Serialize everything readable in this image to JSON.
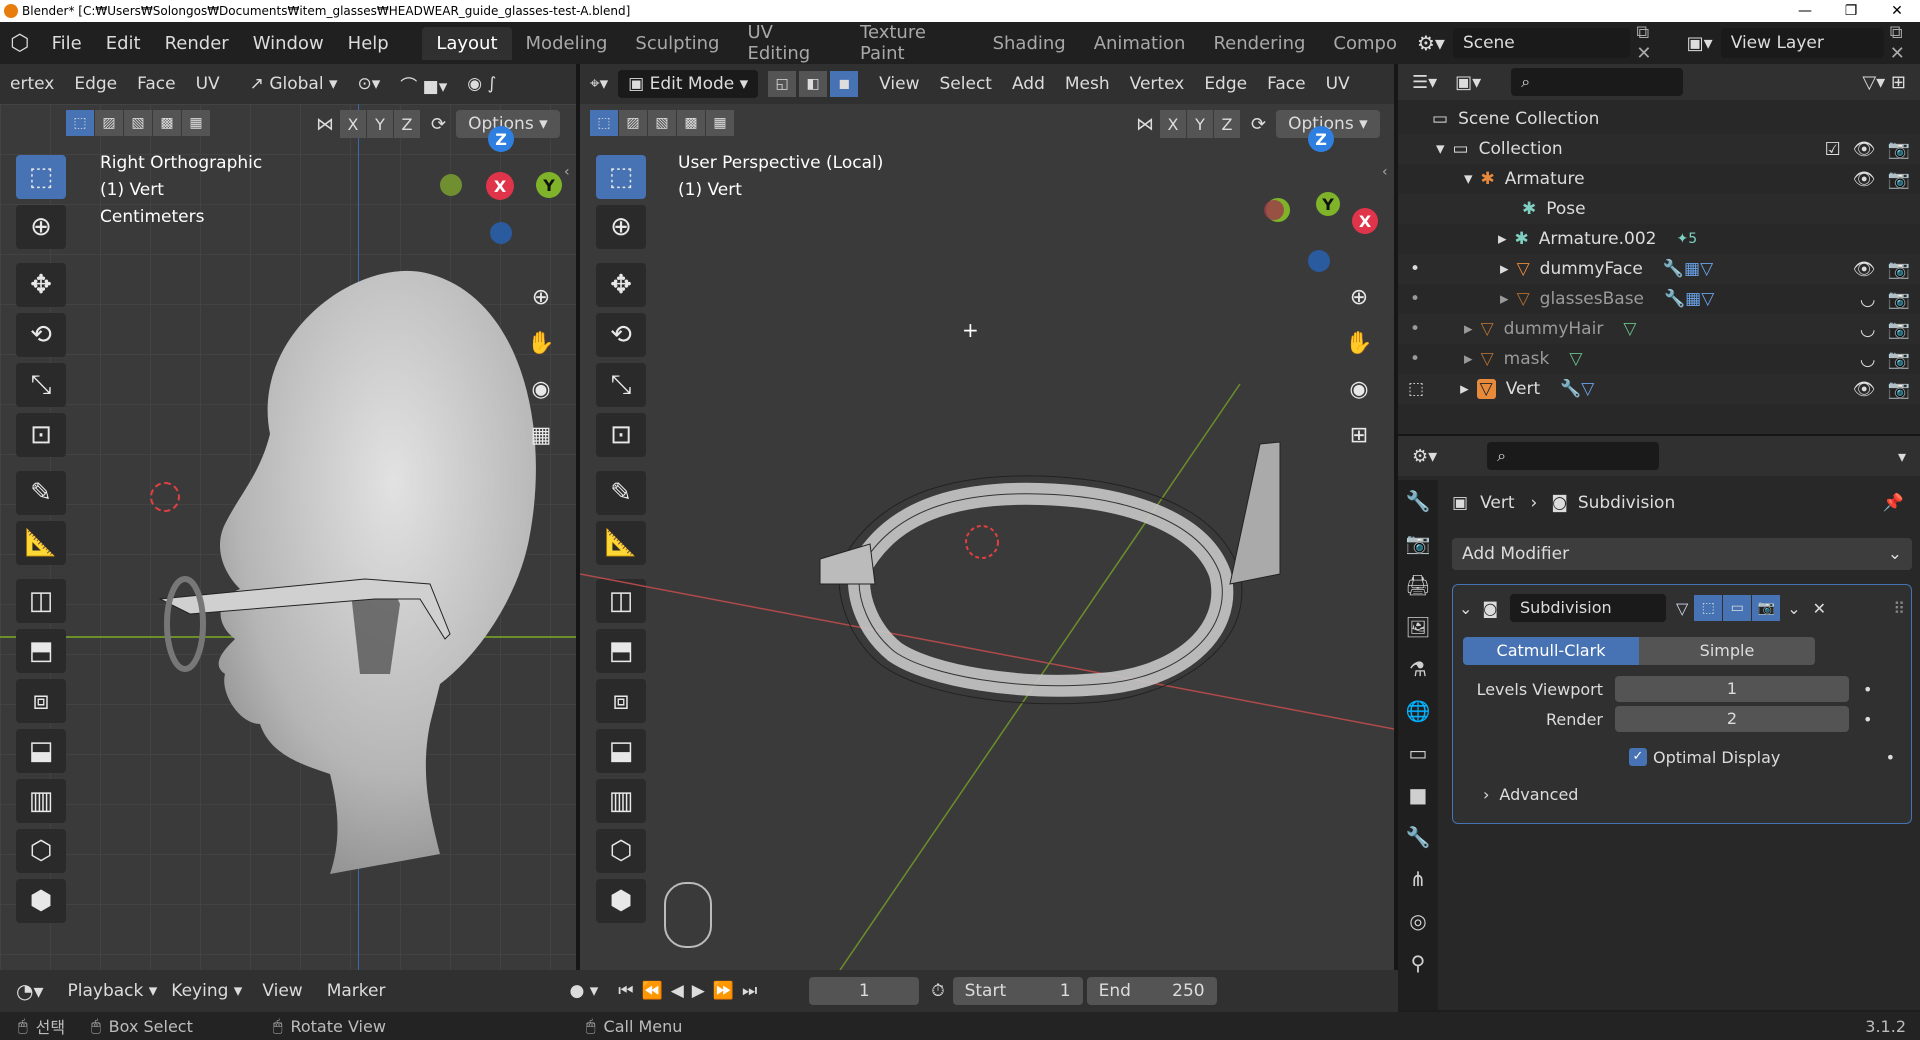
{
  "window": {
    "title": "Blender* [C:₩Users₩Solongos₩Documents₩item_glasses₩HEADWEAR_guide_glasses-test-A.blend]",
    "controls": [
      "—",
      "❐",
      "✕"
    ]
  },
  "menu": [
    "File",
    "Edit",
    "Render",
    "Window",
    "Help"
  ],
  "workspaces": [
    "Layout",
    "Modeling",
    "Sculpting",
    "UV Editing",
    "Texture Paint",
    "Shading",
    "Animation",
    "Rendering",
    "Compo"
  ],
  "active_workspace": "Layout",
  "scene": {
    "label": "Scene",
    "view_layer": "View Layer"
  },
  "left_view": {
    "header_menus": [
      "ertex",
      "Edge",
      "Face",
      "UV"
    ],
    "orientation": "Global",
    "options": "Options",
    "axes": [
      "X",
      "Y",
      "Z"
    ],
    "overlay_lines": [
      "Right Orthographic",
      "(1) Vert",
      "Centimeters"
    ]
  },
  "right_view": {
    "mode": "Edit Mode",
    "header_menus": [
      "View",
      "Select",
      "Add",
      "Mesh",
      "Vertex",
      "Edge",
      "Face",
      "UV"
    ],
    "options": "Options",
    "axes": [
      "X",
      "Y",
      "Z"
    ],
    "overlay_lines": [
      "User Perspective (Local)",
      "(1) Vert"
    ]
  },
  "gizmo": {
    "x": "X",
    "y": "Y",
    "z": "Z",
    "colors": {
      "x": "#e0344b",
      "y": "#7fb32a",
      "z": "#2f7fe0"
    }
  },
  "outliner": {
    "rows": [
      {
        "label": "Scene Collection",
        "indent": 0
      },
      {
        "label": "Collection",
        "indent": 1
      },
      {
        "label": "Armature",
        "indent": 2
      },
      {
        "label": "Pose",
        "indent": 3
      },
      {
        "label": "Armature.002",
        "indent": 3,
        "badge": "5"
      },
      {
        "label": "dummyFace",
        "indent": 3
      },
      {
        "label": "glassesBase",
        "indent": 3
      },
      {
        "label": "dummyHair",
        "indent": 2
      },
      {
        "label": "mask",
        "indent": 2
      },
      {
        "label": "Vert",
        "indent": 2
      }
    ]
  },
  "properties": {
    "breadcrumb_object": "Vert",
    "breadcrumb_modifier": "Subdivision",
    "add_modifier": "Add Modifier",
    "modifier_name": "Subdivision",
    "subdiv_types": [
      "Catmull-Clark",
      "Simple"
    ],
    "active_subdiv_type": "Catmull-Clark",
    "levels_viewport_label": "Levels Viewport",
    "levels_viewport_value": "1",
    "render_label": "Render",
    "render_value": "2",
    "optimal_display_label": "Optimal Display",
    "optimal_display_checked": true,
    "advanced_label": "Advanced"
  },
  "timeline": {
    "menus": [
      "Playback",
      "Keying",
      "View",
      "Marker"
    ],
    "current_frame": "1",
    "start_label": "Start",
    "start_value": "1",
    "end_label": "End",
    "end_value": "250"
  },
  "statusbar": {
    "select": "선택",
    "box_select": "Box Select",
    "rotate_view": "Rotate View",
    "call_menu": "Call Menu",
    "version": "3.1.2"
  }
}
